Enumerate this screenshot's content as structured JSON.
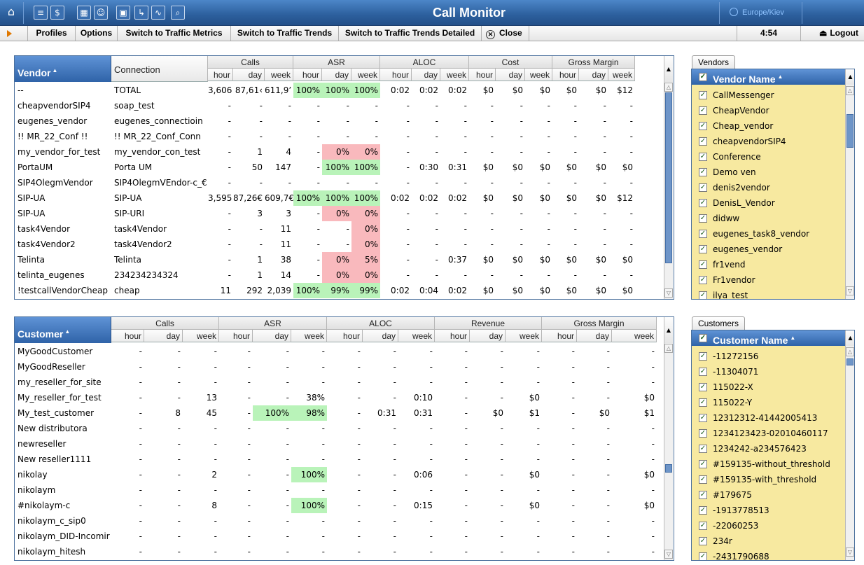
{
  "app": {
    "title": "Call Monitor",
    "timezone": "Europe/Kiev"
  },
  "titlebar_icons": [
    "home-icon",
    "list-icon",
    "dollar-icon",
    "grid-icon",
    "person-icon",
    "network-icon",
    "export-icon",
    "chart-icon",
    "search-icon"
  ],
  "toolbar": {
    "profiles": "Profiles",
    "options": "Options",
    "traffic_metrics": "Switch to Traffic Metrics",
    "traffic_trends": "Switch to Traffic Trends",
    "traffic_trends_detailed": "Switch to Traffic Trends Detailed",
    "close": "Close",
    "time": "4:54",
    "logout": "Logout"
  },
  "vendor_table": {
    "main_header": "Vendor",
    "second_header": "Connection",
    "groups": [
      "Calls",
      "ASR",
      "ALOC",
      "Cost",
      "Gross Margin"
    ],
    "subheaders": [
      "hour",
      "day",
      "week",
      "hour",
      "day",
      "week",
      "hour",
      "day",
      "week",
      "hour",
      "day",
      "week",
      "hour",
      "day",
      "week"
    ],
    "rows": [
      {
        "name": "--",
        "conn": "TOTAL",
        "v": [
          "3,606",
          "87,61‹",
          "611,9’",
          "100%",
          "100%",
          "100%",
          "0:02",
          "0:02",
          "0:02",
          "$0",
          "$0",
          "$0",
          "$0",
          "$0",
          "$12"
        ],
        "hl": [
          "",
          "",
          "",
          "g",
          "g",
          "g",
          "",
          "",
          "",
          "",
          "",
          "",
          "",
          "",
          ""
        ]
      },
      {
        "name": "cheapvendorSIP4",
        "conn": "soap_test",
        "v": [
          "-",
          "-",
          "-",
          "-",
          "-",
          "-",
          "-",
          "-",
          "-",
          "-",
          "-",
          "-",
          "-",
          "-",
          "-"
        ],
        "hl": [
          "",
          "",
          "",
          "",
          "",
          "",
          "",
          "",
          "",
          "",
          "",
          "",
          "",
          "",
          ""
        ]
      },
      {
        "name": "eugenes_vendor",
        "conn": "eugenes_connectioin",
        "v": [
          "-",
          "-",
          "-",
          "-",
          "-",
          "-",
          "-",
          "-",
          "-",
          "-",
          "-",
          "-",
          "-",
          "-",
          "-"
        ],
        "hl": [
          "",
          "",
          "",
          "",
          "",
          "",
          "",
          "",
          "",
          "",
          "",
          "",
          "",
          "",
          ""
        ]
      },
      {
        "name": "!! MR_22_Conf !!",
        "conn": "!! MR_22_Conf_Conn",
        "v": [
          "-",
          "-",
          "-",
          "-",
          "-",
          "-",
          "-",
          "-",
          "-",
          "-",
          "-",
          "-",
          "-",
          "-",
          "-"
        ],
        "hl": [
          "",
          "",
          "",
          "",
          "",
          "",
          "",
          "",
          "",
          "",
          "",
          "",
          "",
          "",
          ""
        ]
      },
      {
        "name": "my_vendor_for_test",
        "conn": "my_vendor_con_test",
        "v": [
          "-",
          "1",
          "4",
          "-",
          "0%",
          "0%",
          "-",
          "-",
          "-",
          "-",
          "-",
          "-",
          "-",
          "-",
          "-"
        ],
        "hl": [
          "",
          "",
          "",
          "",
          "p",
          "p",
          "",
          "",
          "",
          "",
          "",
          "",
          "",
          "",
          ""
        ]
      },
      {
        "name": "PortaUM",
        "conn": "Porta UM",
        "v": [
          "-",
          "50",
          "147",
          "-",
          "100%",
          "100%",
          "-",
          "0:30",
          "0:31",
          "$0",
          "$0",
          "$0",
          "$0",
          "$0",
          "$0"
        ],
        "hl": [
          "",
          "",
          "",
          "",
          "g",
          "g",
          "",
          "",
          "",
          "",
          "",
          "",
          "",
          "",
          ""
        ]
      },
      {
        "name": "SIP4OlegmVendor",
        "conn": "SIP4OlegmVEndor-c_€",
        "v": [
          "-",
          "-",
          "-",
          "-",
          "-",
          "-",
          "-",
          "-",
          "-",
          "-",
          "-",
          "-",
          "-",
          "-",
          "-"
        ],
        "hl": [
          "",
          "",
          "",
          "",
          "",
          "",
          "",
          "",
          "",
          "",
          "",
          "",
          "",
          "",
          ""
        ]
      },
      {
        "name": "SIP-UA",
        "conn": "SIP-UA",
        "v": [
          "3,595",
          "87,26€",
          "609,7€",
          "100%",
          "100%",
          "100%",
          "0:02",
          "0:02",
          "0:02",
          "$0",
          "$0",
          "$0",
          "$0",
          "$0",
          "$12"
        ],
        "hl": [
          "",
          "",
          "",
          "g",
          "g",
          "g",
          "",
          "",
          "",
          "",
          "",
          "",
          "",
          "",
          ""
        ]
      },
      {
        "name": "SIP-UA",
        "conn": "SIP-URI",
        "v": [
          "-",
          "3",
          "3",
          "-",
          "0%",
          "0%",
          "-",
          "-",
          "-",
          "-",
          "-",
          "-",
          "-",
          "-",
          "-"
        ],
        "hl": [
          "",
          "",
          "",
          "",
          "p",
          "p",
          "",
          "",
          "",
          "",
          "",
          "",
          "",
          "",
          ""
        ]
      },
      {
        "name": "task4Vendor",
        "conn": "task4Vendor",
        "v": [
          "-",
          "-",
          "11",
          "-",
          "-",
          "0%",
          "-",
          "-",
          "-",
          "-",
          "-",
          "-",
          "-",
          "-",
          "-"
        ],
        "hl": [
          "",
          "",
          "",
          "",
          "",
          "p",
          "",
          "",
          "",
          "",
          "",
          "",
          "",
          "",
          ""
        ]
      },
      {
        "name": "task4Vendor2",
        "conn": "task4Vendor2",
        "v": [
          "-",
          "-",
          "11",
          "-",
          "-",
          "0%",
          "-",
          "-",
          "-",
          "-",
          "-",
          "-",
          "-",
          "-",
          "-"
        ],
        "hl": [
          "",
          "",
          "",
          "",
          "",
          "p",
          "",
          "",
          "",
          "",
          "",
          "",
          "",
          "",
          ""
        ]
      },
      {
        "name": "Telinta",
        "conn": "Telinta",
        "v": [
          "-",
          "1",
          "38",
          "-",
          "0%",
          "5%",
          "-",
          "-",
          "0:37",
          "$0",
          "$0",
          "$0",
          "$0",
          "$0",
          "$0"
        ],
        "hl": [
          "",
          "",
          "",
          "",
          "p",
          "p",
          "",
          "",
          "",
          "",
          "",
          "",
          "",
          "",
          ""
        ]
      },
      {
        "name": "telinta_eugenes",
        "conn": "234234234324",
        "v": [
          "-",
          "1",
          "14",
          "-",
          "0%",
          "0%",
          "-",
          "-",
          "-",
          "-",
          "-",
          "-",
          "-",
          "-",
          "-"
        ],
        "hl": [
          "",
          "",
          "",
          "",
          "p",
          "p",
          "",
          "",
          "",
          "",
          "",
          "",
          "",
          "",
          ""
        ]
      },
      {
        "name": "!testcallVendorCheap",
        "conn": "cheap",
        "v": [
          "11",
          "292",
          "2,039",
          "100%",
          "99%",
          "99%",
          "0:02",
          "0:04",
          "0:02",
          "$0",
          "$0",
          "$0",
          "$0",
          "$0",
          "$0"
        ],
        "hl": [
          "",
          "",
          "",
          "g",
          "g",
          "g",
          "",
          "",
          "",
          "",
          "",
          "",
          "",
          "",
          ""
        ]
      }
    ]
  },
  "customer_table": {
    "main_header": "Customer",
    "groups": [
      "Calls",
      "ASR",
      "ALOC",
      "Revenue",
      "Gross Margin"
    ],
    "subheaders": [
      "hour",
      "day",
      "week",
      "hour",
      "day",
      "week",
      "hour",
      "day",
      "week",
      "hour",
      "day",
      "week",
      "hour",
      "day",
      "week"
    ],
    "rows": [
      {
        "name": "MyGoodCustomer",
        "v": [
          "-",
          "-",
          "-",
          "-",
          "-",
          "-",
          "-",
          "-",
          "-",
          "-",
          "-",
          "-",
          "-",
          "-",
          "-"
        ],
        "hl": [
          "",
          "",
          "",
          "",
          "",
          "",
          "",
          "",
          "",
          "",
          "",
          "",
          "",
          "",
          ""
        ]
      },
      {
        "name": "MyGoodReseller",
        "v": [
          "-",
          "-",
          "-",
          "-",
          "-",
          "-",
          "-",
          "-",
          "-",
          "-",
          "-",
          "-",
          "-",
          "-",
          "-"
        ],
        "hl": [
          "",
          "",
          "",
          "",
          "",
          "",
          "",
          "",
          "",
          "",
          "",
          "",
          "",
          "",
          ""
        ]
      },
      {
        "name": "my_reseller_for_site",
        "v": [
          "-",
          "-",
          "-",
          "-",
          "-",
          "-",
          "-",
          "-",
          "-",
          "-",
          "-",
          "-",
          "-",
          "-",
          "-"
        ],
        "hl": [
          "",
          "",
          "",
          "",
          "",
          "",
          "",
          "",
          "",
          "",
          "",
          "",
          "",
          "",
          ""
        ]
      },
      {
        "name": "My_reseller_for_test",
        "v": [
          "-",
          "-",
          "13",
          "-",
          "-",
          "38%",
          "-",
          "-",
          "0:10",
          "-",
          "-",
          "$0",
          "-",
          "-",
          "$0"
        ],
        "hl": [
          "",
          "",
          "",
          "",
          "",
          "",
          "",
          "",
          "",
          "",
          "",
          "",
          "",
          "",
          ""
        ]
      },
      {
        "name": "My_test_customer",
        "v": [
          "-",
          "8",
          "45",
          "-",
          "100%",
          "98%",
          "-",
          "0:31",
          "0:31",
          "-",
          "$0",
          "$1",
          "-",
          "$0",
          "$1"
        ],
        "hl": [
          "",
          "",
          "",
          "",
          "g",
          "g",
          "",
          "",
          "",
          "",
          "",
          "",
          "",
          "",
          ""
        ]
      },
      {
        "name": "New distributora",
        "v": [
          "-",
          "-",
          "-",
          "-",
          "-",
          "-",
          "-",
          "-",
          "-",
          "-",
          "-",
          "-",
          "-",
          "-",
          "-"
        ],
        "hl": [
          "",
          "",
          "",
          "",
          "",
          "",
          "",
          "",
          "",
          "",
          "",
          "",
          "",
          "",
          ""
        ]
      },
      {
        "name": "newreseller",
        "v": [
          "-",
          "-",
          "-",
          "-",
          "-",
          "-",
          "-",
          "-",
          "-",
          "-",
          "-",
          "-",
          "-",
          "-",
          "-"
        ],
        "hl": [
          "",
          "",
          "",
          "",
          "",
          "",
          "",
          "",
          "",
          "",
          "",
          "",
          "",
          "",
          ""
        ]
      },
      {
        "name": "New reseller1111",
        "v": [
          "-",
          "-",
          "-",
          "-",
          "-",
          "-",
          "-",
          "-",
          "-",
          "-",
          "-",
          "-",
          "-",
          "-",
          "-"
        ],
        "hl": [
          "",
          "",
          "",
          "",
          "",
          "",
          "",
          "",
          "",
          "",
          "",
          "",
          "",
          "",
          ""
        ]
      },
      {
        "name": "nikolay",
        "v": [
          "-",
          "-",
          "2",
          "-",
          "-",
          "100%",
          "-",
          "-",
          "0:06",
          "-",
          "-",
          "$0",
          "-",
          "-",
          "$0"
        ],
        "hl": [
          "",
          "",
          "",
          "",
          "",
          "g",
          "",
          "",
          "",
          "",
          "",
          "",
          "",
          "",
          ""
        ]
      },
      {
        "name": "nikolaym",
        "v": [
          "-",
          "-",
          "-",
          "-",
          "-",
          "-",
          "-",
          "-",
          "-",
          "-",
          "-",
          "-",
          "-",
          "-",
          "-"
        ],
        "hl": [
          "",
          "",
          "",
          "",
          "",
          "",
          "",
          "",
          "",
          "",
          "",
          "",
          "",
          "",
          ""
        ]
      },
      {
        "name": "#nikolaym-c",
        "v": [
          "-",
          "-",
          "8",
          "-",
          "-",
          "100%",
          "-",
          "-",
          "0:15",
          "-",
          "-",
          "$0",
          "-",
          "-",
          "$0"
        ],
        "hl": [
          "",
          "",
          "",
          "",
          "",
          "g",
          "",
          "",
          "",
          "",
          "",
          "",
          "",
          "",
          ""
        ]
      },
      {
        "name": "nikolaym_c_sip0",
        "v": [
          "-",
          "-",
          "-",
          "-",
          "-",
          "-",
          "-",
          "-",
          "-",
          "-",
          "-",
          "-",
          "-",
          "-",
          "-"
        ],
        "hl": [
          "",
          "",
          "",
          "",
          "",
          "",
          "",
          "",
          "",
          "",
          "",
          "",
          "",
          "",
          ""
        ]
      },
      {
        "name": "nikolaym_DID-Incomir",
        "v": [
          "-",
          "-",
          "-",
          "-",
          "-",
          "-",
          "-",
          "-",
          "-",
          "-",
          "-",
          "-",
          "-",
          "-",
          "-"
        ],
        "hl": [
          "",
          "",
          "",
          "",
          "",
          "",
          "",
          "",
          "",
          "",
          "",
          "",
          "",
          "",
          ""
        ]
      },
      {
        "name": "nikolaym_hitesh",
        "v": [
          "-",
          "-",
          "-",
          "-",
          "-",
          "-",
          "-",
          "-",
          "-",
          "-",
          "-",
          "-",
          "-",
          "-",
          "-"
        ],
        "hl": [
          "",
          "",
          "",
          "",
          "",
          "",
          "",
          "",
          "",
          "",
          "",
          "",
          "",
          "",
          ""
        ]
      }
    ]
  },
  "vendors_panel": {
    "tab": "Vendors",
    "header": "Vendor Name",
    "items": [
      "CallMessenger",
      "CheapVendor",
      "Cheap_vendor",
      "cheapvendorSIP4",
      "Conference",
      "Demo ven",
      "denis2vendor",
      "DenisL_Vendor",
      "didww",
      "eugenes_task8_vendor",
      "eugenes_vendor",
      "fr1vend",
      "Fr1vendor",
      "ilya_test"
    ]
  },
  "customers_panel": {
    "tab": "Customers",
    "header": "Customer Name",
    "items": [
      "-11272156",
      "-11304071",
      "115022-X",
      "115022-Y",
      "12312312-41442005413",
      "1234123423-02010460117",
      "1234242-a234576423",
      "#159135-without_threshold",
      "#159135-with_threshold",
      "#179675",
      "-1913778513",
      "-22060253",
      "234r",
      "-2431790688"
    ]
  }
}
